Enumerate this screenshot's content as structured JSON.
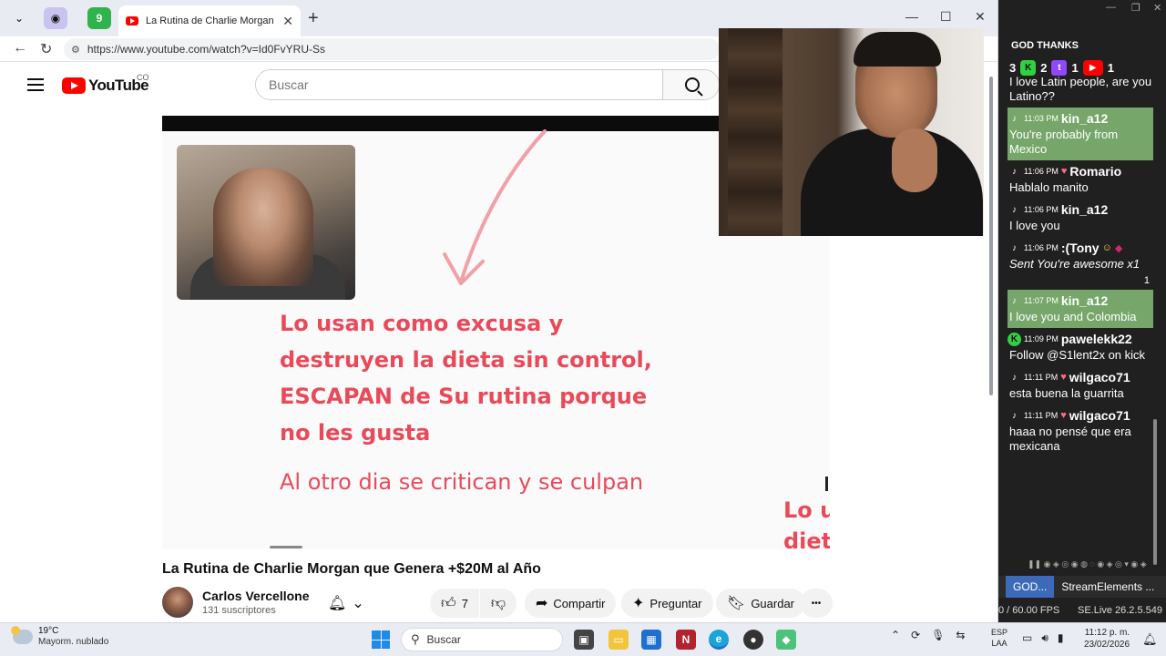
{
  "browser": {
    "tab_title": "La Rutina de Charlie Morgan que Genera +$20M al Año - YouTube",
    "url": "https://www.youtube.com/watch?v=Id0FvYRU-Ss",
    "tab2_badge": "9"
  },
  "youtube": {
    "logo_text": "YouTube",
    "country": "CO",
    "search_placeholder": "Buscar",
    "video_title": "La Rutina de Charlie Morgan que Genera +$20M al Año",
    "channel_name": "Carlos Vercellone",
    "channel_subs": "131 suscriptores",
    "likes": "7",
    "share_label": "Compartir",
    "ask_label": "Preguntar",
    "save_label": "Guardar",
    "more_label": "•••"
  },
  "slide": {
    "lines": [
      "Lo usan como excusa y",
      "destruyen la dieta sin control,",
      "ESCAPAN de Su rutina porque",
      "no les gusta"
    ],
    "subtext": "Al otro dia se critican y se culpan",
    "edge_text_1": "Lo u",
    "edge_text_2": "diet",
    "accent_color": "#e84a5a"
  },
  "chat": {
    "header": "GOD THANKS",
    "counts": {
      "kick": "2",
      "twitch": "1",
      "youtube": "1",
      "other": "3"
    },
    "messages": [
      {
        "platform": "none",
        "time": "",
        "user": "",
        "text": "I love Latin people, are you Latino??",
        "highlight": false,
        "italic": false
      },
      {
        "platform": "tiktok",
        "time": "11:03 PM",
        "user": "kin_a12",
        "text": "You're probably from Mexico",
        "highlight": true,
        "italic": false
      },
      {
        "platform": "tiktok",
        "time": "11:06 PM",
        "user": "Romario",
        "text": "Hablalo manito",
        "highlight": false,
        "italic": false
      },
      {
        "platform": "tiktok",
        "time": "11:06 PM",
        "user": "kin_a12",
        "text": "I love you",
        "highlight": false,
        "italic": false
      },
      {
        "platform": "tiktok",
        "time": "11:06 PM",
        "user": ":(Tony",
        "text": "Sent You're awesome x1",
        "highlight": false,
        "italic": true,
        "gift_count": "1"
      },
      {
        "platform": "tiktok",
        "time": "11:07 PM",
        "user": "kin_a12",
        "text": "I love you and Colombia",
        "highlight": true,
        "italic": false
      },
      {
        "platform": "kick",
        "time": "11:09 PM",
        "user": "pawelekk22",
        "text": "Follow @S1lent2x on kick",
        "highlight": false,
        "italic": false
      },
      {
        "platform": "tiktok",
        "time": "11:11 PM",
        "user": "wilgaco71",
        "text": "esta buena la guarrita",
        "highlight": false,
        "italic": false
      },
      {
        "platform": "tiktok",
        "time": "11:11 PM",
        "user": "wilgaco71",
        "text": "haaa no pensé que era mexicana",
        "highlight": false,
        "italic": false
      }
    ],
    "tab1": "GOD...",
    "tab2": "StreamElements ...",
    "fps": "0 / 60.00 FPS",
    "version": "SE.Live 26.2.5.549"
  },
  "taskbar": {
    "temp": "19°C",
    "weather": "Mayorm. nublado",
    "search_label": "Buscar",
    "lang_1": "ESP",
    "lang_2": "LAA",
    "time": "11:12 p. m.",
    "date": "23/02/2026"
  }
}
